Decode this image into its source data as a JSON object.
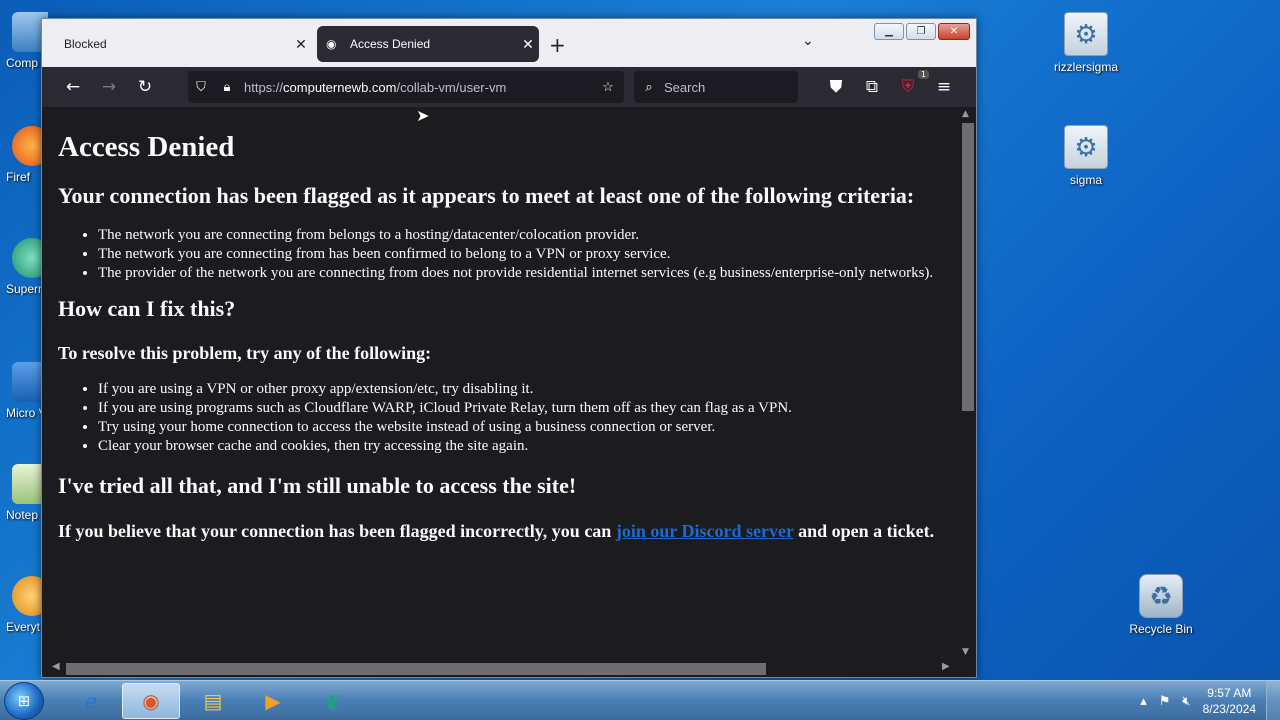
{
  "desktop": {
    "left_icons": [
      "Comp",
      "Firef",
      "Superm",
      "Micro Visual S",
      "Notep",
      "Everyt"
    ],
    "right_icons": [
      {
        "label": "rizzlersigma",
        "icon": "settings-gear-icon"
      },
      {
        "label": "sigma",
        "icon": "settings-gear-icon"
      },
      {
        "label": "Recycle Bin",
        "icon": "recycle-bin-icon"
      }
    ]
  },
  "browser": {
    "tabs": [
      {
        "title": "Blocked",
        "active": false
      },
      {
        "title": "Access Denied",
        "active": true
      }
    ],
    "url_prefix": "https://",
    "url_host": "computernewb.com",
    "url_path": "/collab-vm/user-vm",
    "search_placeholder": "Search",
    "extension_badge": "1"
  },
  "page": {
    "title": "Access Denied",
    "flag_heading": "Your connection has been flagged as it appears to meet at least one of the following criteria:",
    "criteria": [
      "The network you are connecting from belongs to a hosting/datacenter/colocation provider.",
      "The network you are connecting from has been confirmed to belong to a VPN or proxy service.",
      "The provider of the network you are connecting from does not provide residential internet services (e.g business/enterprise-only networks)."
    ],
    "fix_heading": "How can I fix this?",
    "resolve_heading": "To resolve this problem, try any of the following:",
    "fixes": [
      "If you are using a VPN or other proxy app/extension/etc, try disabling it.",
      "If you are using programs such as Cloudflare WARP, iCloud Private Relay, turn them off as they can flag as a VPN.",
      "Try using your home connection to access the website instead of using a business connection or server.",
      "Clear your browser cache and cookies, then try accessing the site again."
    ],
    "still_heading": "I've tried all that, and I'm still unable to access the site!",
    "contact_before": "If you believe that your connection has been flagged incorrectly, you can ",
    "contact_link": "join our Discord server",
    "contact_after": " and open a ticket."
  },
  "taskbar": {
    "time": "9:57 AM",
    "date": "8/23/2024"
  },
  "colors": {
    "page_bg": "#1c1b1e",
    "toolbar_bg": "#2b2a33",
    "link": "#1e6ad2"
  }
}
